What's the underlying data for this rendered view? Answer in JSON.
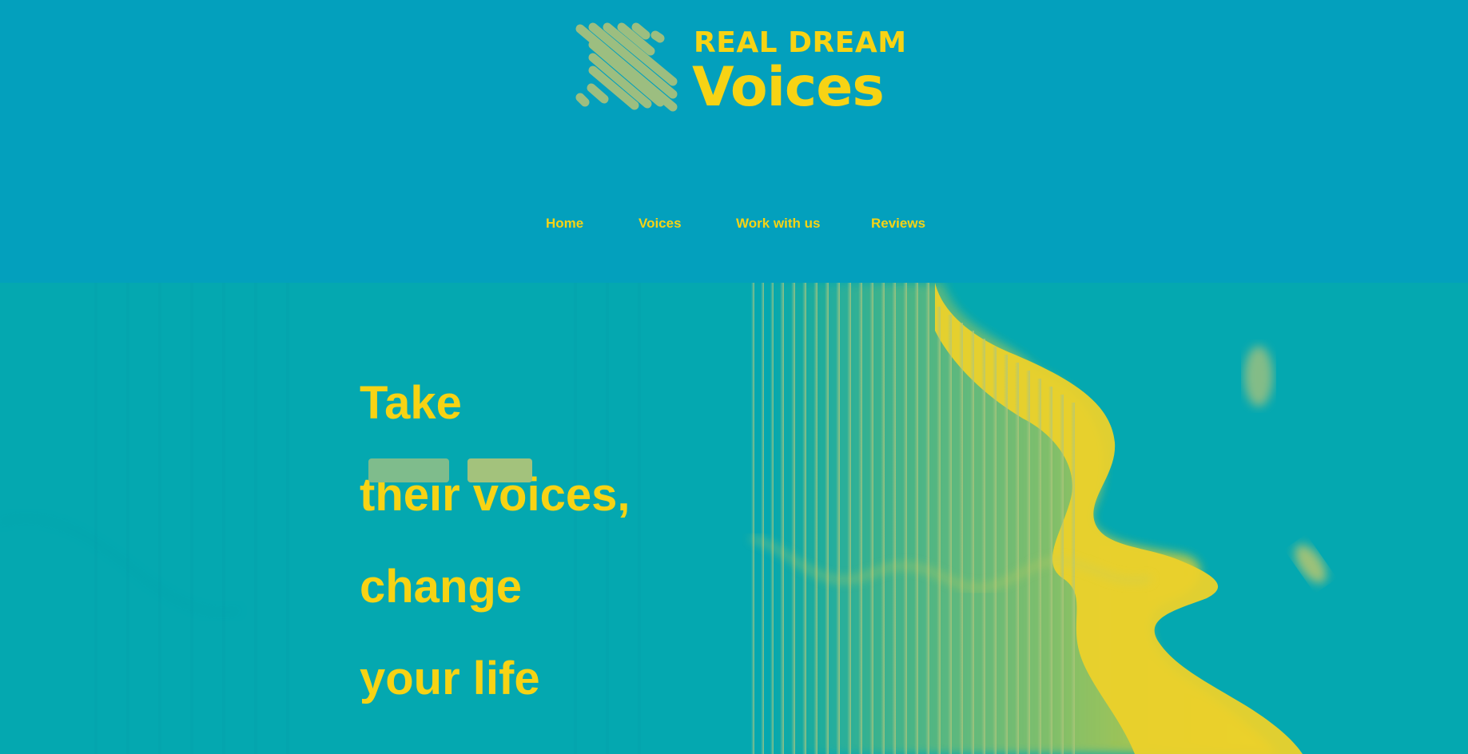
{
  "brand": {
    "name_top": "REAL DREAM",
    "name_main": "Voices"
  },
  "nav": {
    "items": [
      {
        "label": "Home"
      },
      {
        "label": "Voices"
      },
      {
        "label": "Work with us"
      },
      {
        "label": "Reviews"
      }
    ]
  },
  "hero": {
    "headline_lines": [
      "Take",
      "their voices,",
      "change",
      "your life"
    ],
    "buttons": [
      {
        "label": ""
      },
      {
        "label": ""
      }
    ]
  },
  "colors": {
    "header_bg": "#03a0bd",
    "hero_bg": "#04a8b0",
    "accent_yellow": "#f7d314",
    "logo_mark": "#9cbe80",
    "button_primary": "#7fbc8c",
    "button_secondary": "#a3c27c"
  },
  "icons": {
    "logo_mark": "diagonal-stripes-logo-icon"
  }
}
